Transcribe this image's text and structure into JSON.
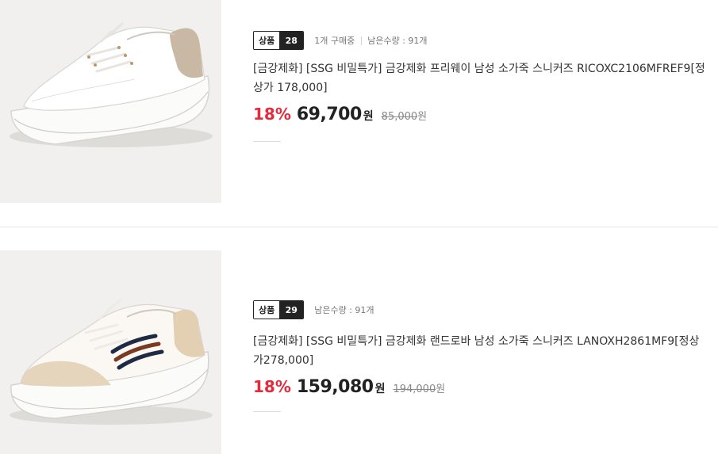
{
  "products": [
    {
      "rank_label": "상품",
      "rank": "28",
      "purchase_count": "1개 구매중",
      "stock": "남은수량 : 91개",
      "title": "[금강제화] [SSG 비밀특가] 금강제화 프리웨이 남성 소가죽 스니커즈 RICOXC2106MFREF9[정상가 178,000]",
      "discount": "18%",
      "price": "69,700",
      "currency": "원",
      "original_price": "85,000",
      "original_currency": "원",
      "image_icon": "white-sneaker-beige-heel-image"
    },
    {
      "rank_label": "상품",
      "rank": "29",
      "stock": "남은수량 : 91개",
      "title": "[금강제화] [SSG 비밀특가] 금강제화 랜드로바 남성 소가죽 스니커즈 LANOXH2861MF9[정상가278,000]",
      "discount": "18%",
      "price": "159,080",
      "currency": "원",
      "original_price": "194,000",
      "original_currency": "원",
      "image_icon": "white-sneaker-stripe-image"
    }
  ],
  "colors": {
    "discount": "#e52b3b",
    "badge_dark": "#222222",
    "thumb_bg": "#f1f0ef"
  }
}
